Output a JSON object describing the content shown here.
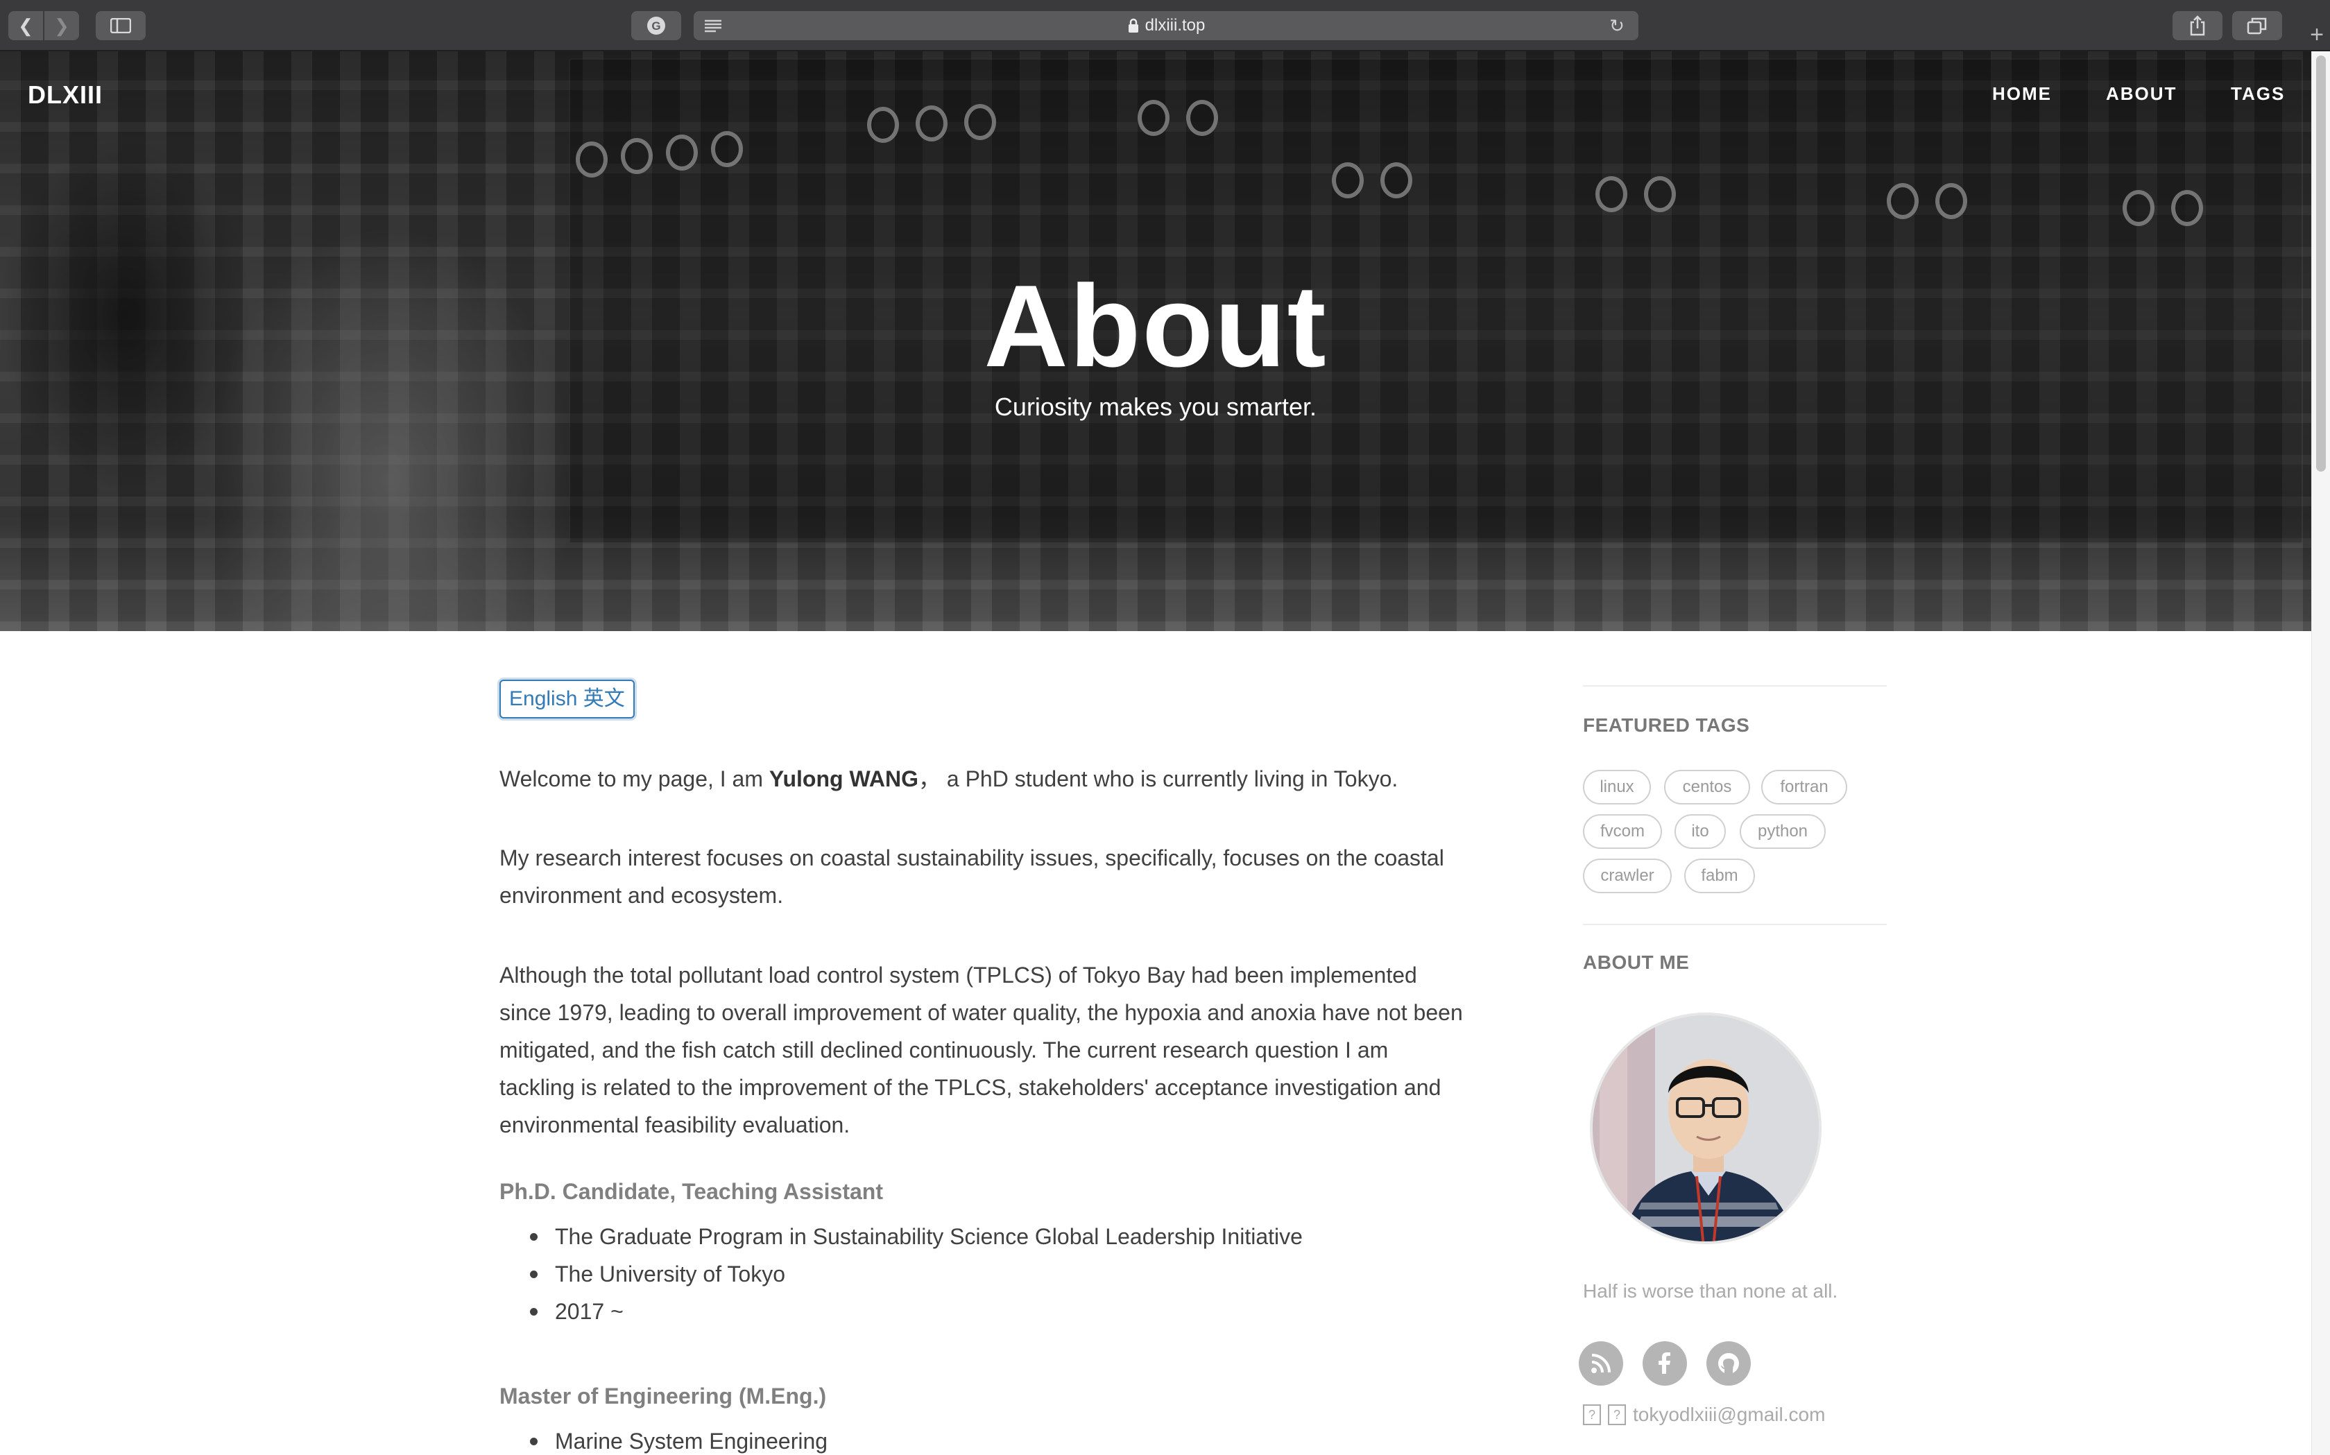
{
  "browser": {
    "url": "dlxiii.top"
  },
  "header": {
    "brand": "DLXIII",
    "nav": [
      "HOME",
      "ABOUT",
      "TAGS"
    ]
  },
  "hero": {
    "title": "About",
    "subtitle": "Curiosity makes you smarter."
  },
  "main": {
    "lang_button": "English 英文",
    "intro_before": "Welcome to my page, I am ",
    "intro_name": "Yulong WANG",
    "intro_after": "， a PhD student who is currently living in Tokyo.",
    "para1_line1": "My research interest focuses on coastal sustainability issues, specifically, focuses on the coastal",
    "para1_line2": "environment and ecosystem.",
    "para2_lines": [
      "Although the total pollutant load control system (TPLCS) of Tokyo Bay had been implemented",
      "since 1979, leading to overall improvement of water quality, the hypoxia and anoxia have not been",
      "mitigated, and the fish catch still declined continuously. The current research question I am",
      "tackling is related to the improvement of the TPLCS, stakeholders' acceptance investigation and",
      "environmental feasibility evaluation."
    ],
    "section1_title": "Ph.D. Candidate, Teaching Assistant",
    "section1_items": [
      "The Graduate Program in Sustainability Science Global Leadership Initiative",
      "The University of Tokyo",
      "2017 ~"
    ],
    "section2_title": "Master of Engineering (M.Eng.)",
    "section2_items": [
      "Marine System Engineering"
    ]
  },
  "sidebar": {
    "featured_title": "FEATURED TAGS",
    "tags": [
      "linux",
      "centos",
      "fortran",
      "fvcom",
      "ito",
      "python",
      "crawler",
      "fabm"
    ],
    "about_title": "ABOUT ME",
    "quote": "Half is worse than none at all.",
    "social_icons": [
      "rss-icon",
      "facebook-icon",
      "github-icon"
    ],
    "email": "tokyodlxiii@gmail.com",
    "email_glyphs": [
      "?",
      "?"
    ]
  }
}
